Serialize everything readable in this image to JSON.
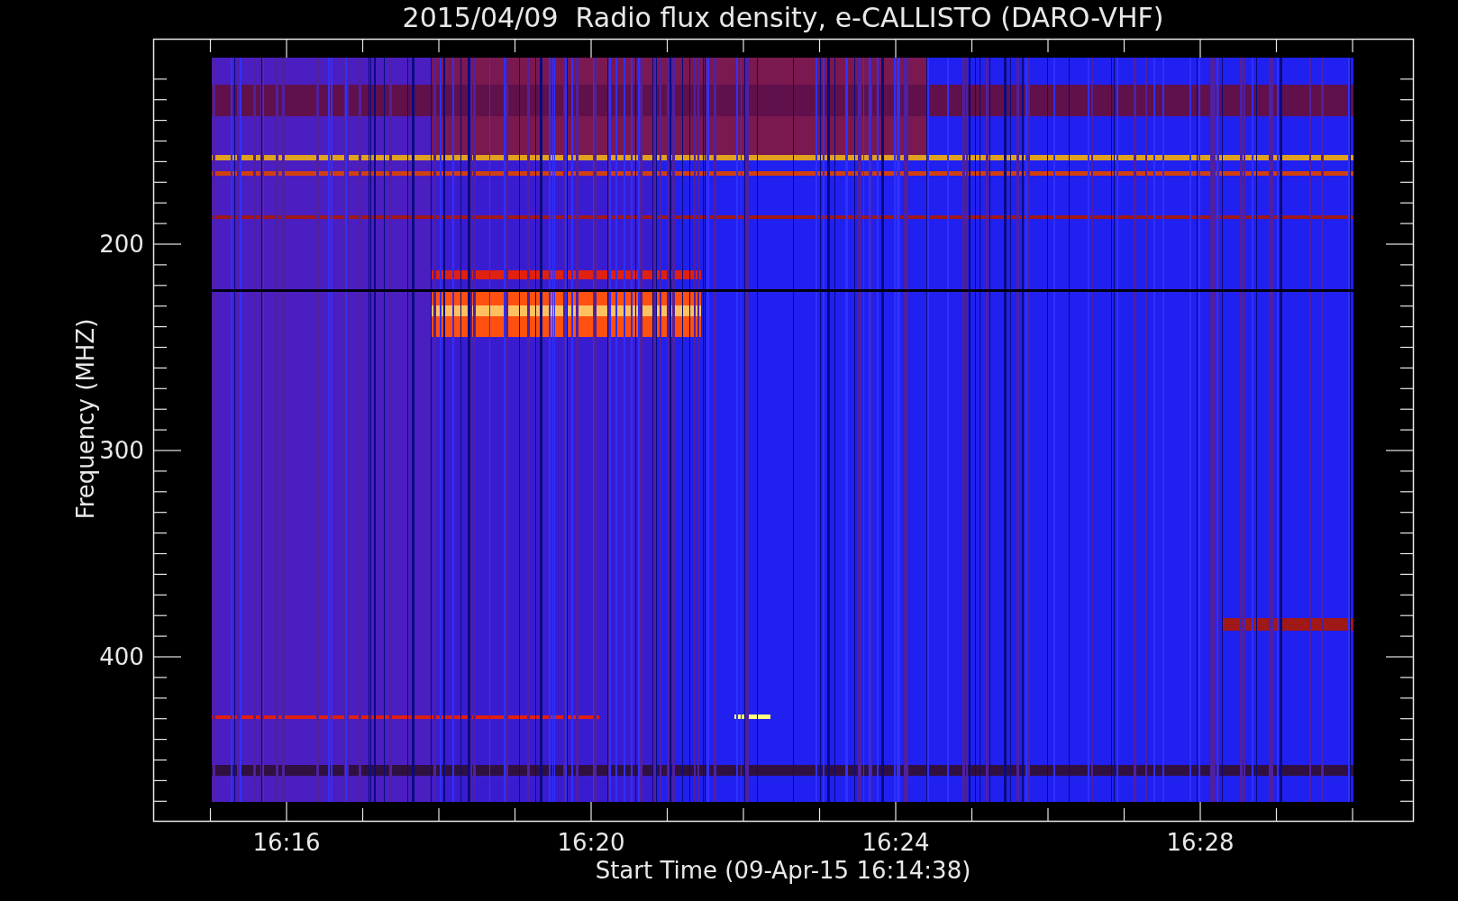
{
  "title": "2015/04/09  Radio flux density, e-CALLISTO (DARO-VHF)",
  "y_axis": {
    "label": "Frequency (MHZ)",
    "ticks": [
      "200",
      "300",
      "400"
    ]
  },
  "x_axis": {
    "label": "Start Time (09-Apr-15 16:14:38)",
    "ticks": [
      "16:16",
      "16:20",
      "16:24",
      "16:28"
    ]
  }
}
